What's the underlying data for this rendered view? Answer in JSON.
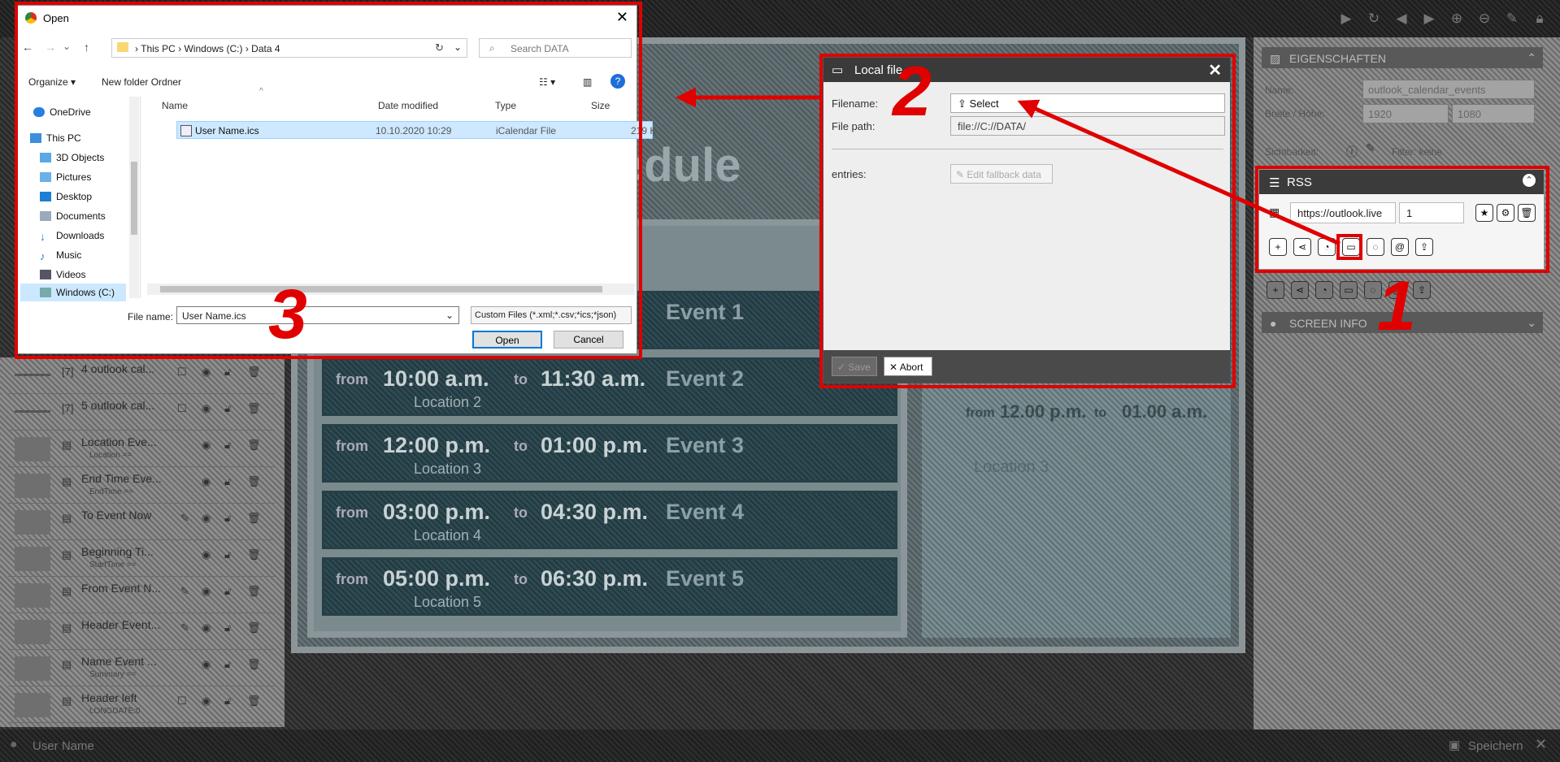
{
  "app": {
    "bottom_user": "User Name",
    "bottom_save": "Speichern"
  },
  "canvas": {
    "schedule_title": "edule",
    "events": [
      {
        "from": "from",
        "start": "",
        "to": "",
        "end": "",
        "name": "Event 1",
        "location": ""
      },
      {
        "from": "from",
        "start": "10:00 a.m.",
        "to": "to",
        "end": "11:30 a.m.",
        "name": "Event 2",
        "location": "Location 2"
      },
      {
        "from": "from",
        "start": "12:00 p.m.",
        "to": "to",
        "end": "01:00 p.m.",
        "name": "Event 3",
        "location": "Location 3"
      },
      {
        "from": "from",
        "start": "03:00 p.m.",
        "to": "to",
        "end": "04:30 p.m.",
        "name": "Event 4",
        "location": "Location 4"
      },
      {
        "from": "from",
        "start": "05:00 p.m.",
        "to": "to",
        "end": "06:30 p.m.",
        "name": "Event 5",
        "location": "Location 5"
      }
    ],
    "side": {
      "from": "from",
      "start": "12.00 p.m.",
      "to": "to",
      "end": "01.00 a.m.",
      "location": "Location 3"
    }
  },
  "layers": [
    {
      "num": "[7]",
      "name": "4 outlook cal...",
      "sub": ""
    },
    {
      "num": "[7]",
      "name": "5 outlook cal...",
      "sub": ""
    },
    {
      "num": "",
      "name": "Location Eve...",
      "sub": "Location =="
    },
    {
      "num": "",
      "name": "End Time Eve...",
      "sub": "EndTime =="
    },
    {
      "num": "",
      "name": "To Event Now",
      "sub": ""
    },
    {
      "num": "",
      "name": "Beginning Ti...",
      "sub": "StartTime =="
    },
    {
      "num": "",
      "name": "From Event N...",
      "sub": ""
    },
    {
      "num": "",
      "name": "Header Event...",
      "sub": ""
    },
    {
      "num": "",
      "name": "Name Event ...",
      "sub": "Summary =="
    },
    {
      "num": "",
      "name": "Header left",
      "sub": "LONGDATE:0"
    }
  ],
  "properties": {
    "header": "EIGENSCHAFTEN",
    "name_label": "Name:",
    "name_value": "outlook_calendar_events",
    "size_label": "Breite / Höhe:",
    "width": "1920",
    "height": "1080",
    "visibility_label": "Sichtbarkeit:",
    "filter_label": "Filter: keine"
  },
  "rss": {
    "header": "RSS",
    "url": "https://outlook.live",
    "count": "1",
    "screen_info": "SCREEN INFO"
  },
  "local_file": {
    "title": "Local file",
    "filename_label": "Filename:",
    "select_label": "Select",
    "filepath_label": "File path:",
    "filepath_value": "file://C://DATA/",
    "entries_label": "entries:",
    "edit_fallback": "Edit fallback data",
    "save": "Save",
    "abort": "Abort"
  },
  "open_dialog": {
    "title": "Open",
    "breadcrumb": [
      "This PC",
      "Windows (C:)",
      "Data 4"
    ],
    "search_placeholder": "Search DATA",
    "organize": "Organize",
    "new_folder": "New folder Ordner",
    "nav_items": [
      "OneDrive",
      "This PC",
      "3D Objects",
      "Pictures",
      "Desktop",
      "Documents",
      "Downloads",
      "Music",
      "Videos",
      "Windows (C:)"
    ],
    "columns": [
      "Name",
      "Date modified",
      "Type",
      "Size"
    ],
    "file": {
      "name": "User Name.ics",
      "date": "10.10.2020 10:29",
      "type": "iCalendar File",
      "size": "219 K"
    },
    "filename_label": "File name:",
    "filename_value": "User Name.ics",
    "filter_value": "Custom Files (*.xml;*.csv;*ics;*json)",
    "open_button": "Open",
    "cancel_button": "Cancel"
  },
  "annotations": {
    "one": "1",
    "two": "2",
    "three": "3"
  },
  "colors": {
    "annotation_red": "#e00000",
    "dialog_header": "#3a3a3a",
    "selected_row": "#cde8ff"
  }
}
